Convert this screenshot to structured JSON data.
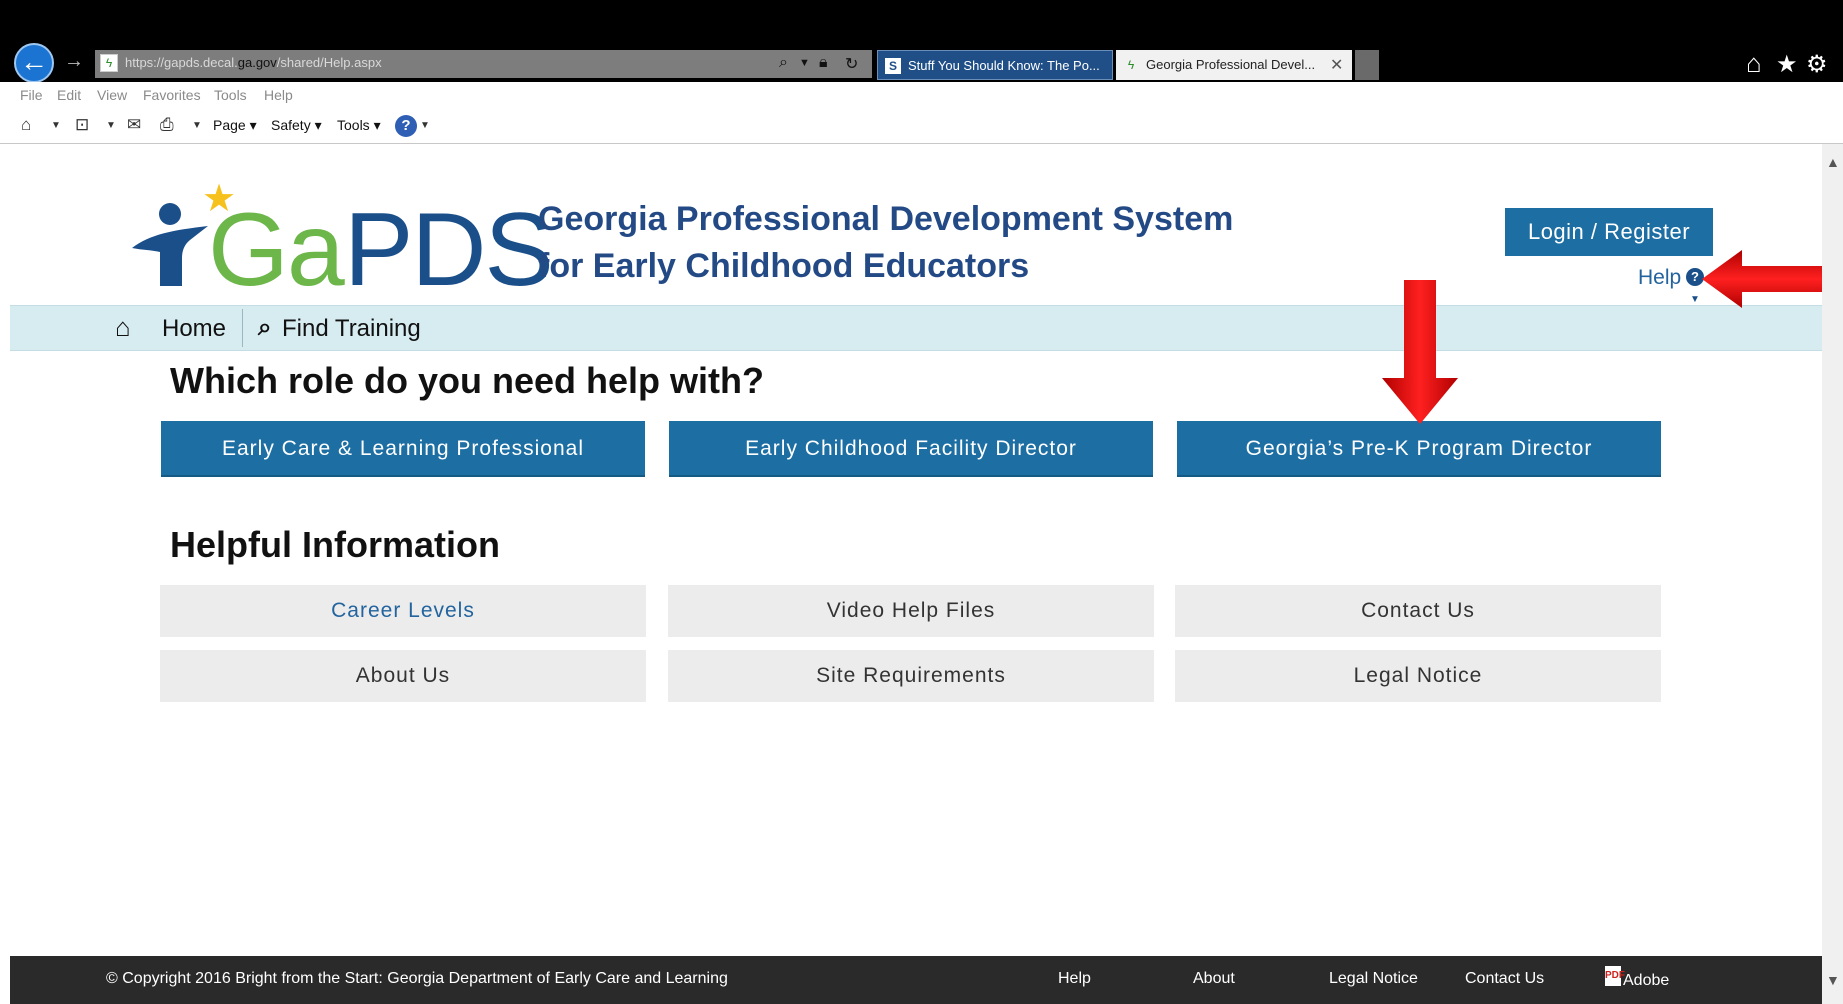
{
  "browser": {
    "address": {
      "pre": "https://gapds.decal.",
      "domain": "ga.gov",
      "post": "/shared/Help.aspx"
    },
    "tabs": [
      {
        "label": "Stuff You Should Know: The Po..."
      },
      {
        "label": "Georgia Professional Devel..."
      }
    ],
    "menu": [
      "File",
      "Edit",
      "View",
      "Favorites",
      "Tools",
      "Help"
    ],
    "commands": {
      "page": "Page ▾",
      "safety": "Safety ▾",
      "tools": "Tools ▾"
    }
  },
  "header": {
    "logo_ga": "Ga",
    "logo_pds": "PDS",
    "title_line1": "Georgia Professional Development System",
    "title_line2": "for Early Childhood Educators",
    "login_label": "Login / Register",
    "help_label": "Help"
  },
  "nav": {
    "home": "Home",
    "find_training": "Find Training"
  },
  "roles": {
    "heading": "Which role do you need help with?",
    "buttons": [
      "Early Care & Learning Professional",
      "Early Childhood Facility Director",
      "Georgia’s Pre-K Program Director"
    ]
  },
  "info": {
    "heading": "Helpful Information",
    "buttons": [
      "Career Levels",
      "Video Help Files",
      "Contact Us",
      "About Us",
      "Site Requirements",
      "Legal Notice"
    ]
  },
  "footer": {
    "copyright": "© Copyright 2016 Bright from the Start: Georgia Department of Early Care and Learning",
    "links": [
      "Help",
      "About",
      "Legal Notice",
      "Contact Us"
    ],
    "adobe": "Adobe"
  },
  "colors": {
    "brand_blue": "#1c6ea3",
    "nav_bg": "#d7ecf1",
    "annotation_red": "#e01010"
  }
}
